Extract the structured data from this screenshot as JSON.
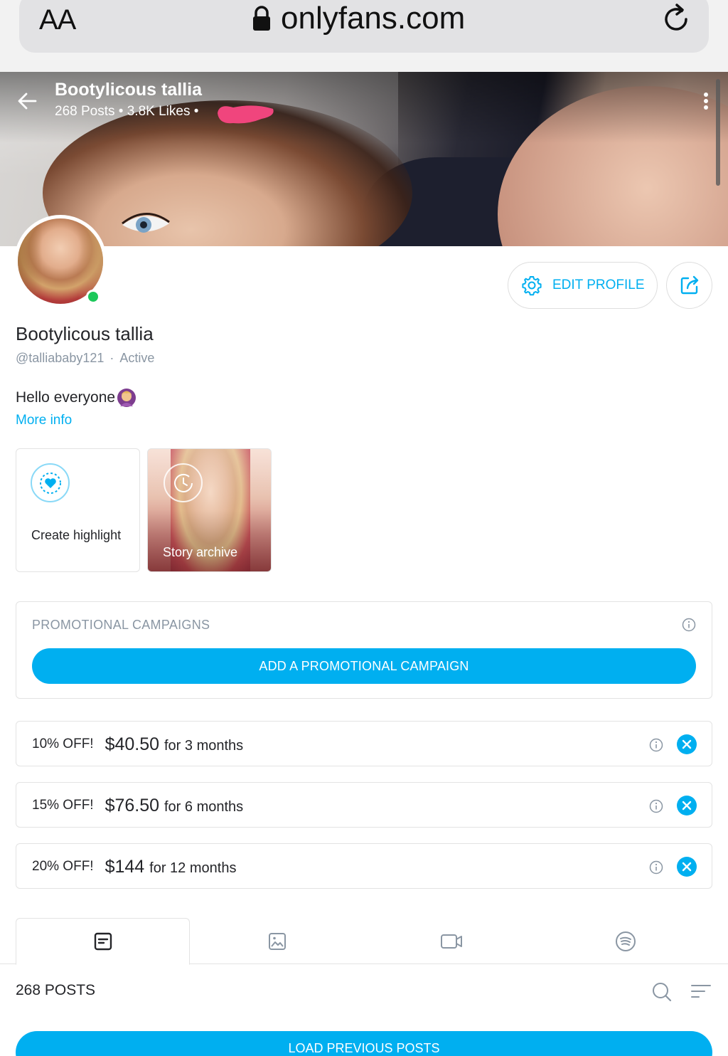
{
  "browser": {
    "text_size_button": "AA",
    "url": "onlyfans.com"
  },
  "header": {
    "title": "Bootylicous tallia",
    "posts": "268 Posts",
    "likes": "3.8K Likes"
  },
  "profile": {
    "name": "Bootylicous tallia",
    "handle": "@talliababy121",
    "status": "Active",
    "bio": "Hello everyone",
    "more_info": "More info",
    "edit_profile_label": "EDIT PROFILE"
  },
  "highlights": [
    {
      "label": "Create highlight"
    },
    {
      "label": "Story archive"
    }
  ],
  "promo": {
    "title": "PROMOTIONAL CAMPAIGNS",
    "add_button": "ADD A PROMOTIONAL CAMPAIGN"
  },
  "offers": [
    {
      "discount": "10% OFF!",
      "price": "$40.50",
      "period": "for 3 months"
    },
    {
      "discount": "15% OFF!",
      "price": "$76.50",
      "period": "for 6 months"
    },
    {
      "discount": "20% OFF!",
      "price": "$144",
      "period": "for 12 months"
    }
  ],
  "tabs": [
    {
      "icon": "posts-icon",
      "active": true
    },
    {
      "icon": "photos-icon",
      "active": false
    },
    {
      "icon": "videos-icon",
      "active": false
    },
    {
      "icon": "audio-icon",
      "active": false
    }
  ],
  "feed": {
    "count_label": "268 POSTS",
    "load_button": "LOAD PREVIOUS POSTS"
  },
  "colors": {
    "accent": "#00aff0",
    "online": "#1cc85a",
    "muted": "#8a96a3",
    "redaction": "#f0457d"
  }
}
